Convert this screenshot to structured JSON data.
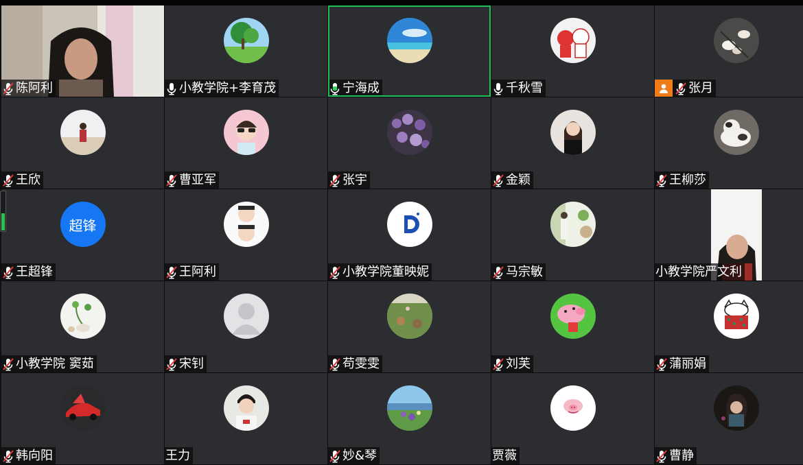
{
  "colors": {
    "tile_bg": "#2b2d31",
    "active_border": "#1ec15a",
    "host_badge": "#f07c19",
    "text_avatar": "#1677f5"
  },
  "audio_level": 0.45,
  "participants": [
    {
      "name": "陈阿利",
      "mic": "muted",
      "avatar": "camera-video"
    },
    {
      "name": "小教学院+李育茂",
      "mic": "on",
      "avatar": "tree-landscape"
    },
    {
      "name": "宁海成",
      "mic": "speaking",
      "avatar": "beach-sky",
      "active": true
    },
    {
      "name": "千秋雪",
      "mic": "on",
      "avatar": "cartoon-pigs"
    },
    {
      "name": "张月",
      "mic": "muted",
      "avatar": "magnolia-flowers",
      "host": true
    },
    {
      "name": "王欣",
      "mic": "muted",
      "avatar": "person-beach"
    },
    {
      "name": "曹亚军",
      "mic": "muted",
      "avatar": "woman-sunglasses"
    },
    {
      "name": "张宇",
      "mic": "muted",
      "avatar": "purple-flowers"
    },
    {
      "name": "金颖",
      "mic": "muted",
      "avatar": "woman-portrait"
    },
    {
      "name": "王柳莎",
      "mic": "muted",
      "avatar": "cat"
    },
    {
      "name": "王超锋",
      "mic": "muted",
      "avatar": "text",
      "avatar_text": "超锋"
    },
    {
      "name": "王阿利",
      "mic": "muted",
      "avatar": "boy-faces"
    },
    {
      "name": "小教学院董映妮",
      "mic": "muted",
      "avatar": "d-logo",
      "logo_letter": "D"
    },
    {
      "name": "马宗敏",
      "mic": "muted",
      "avatar": "woman-garden"
    },
    {
      "name": "小教学院严文利",
      "mic": "none",
      "avatar": "camera-video-card"
    },
    {
      "name": "小教学院 窦茹",
      "mic": "muted",
      "avatar": "vase-plant"
    },
    {
      "name": "宋钊",
      "mic": "muted",
      "avatar": "default-person"
    },
    {
      "name": "苟雯雯",
      "mic": "muted",
      "avatar": "meadow-picnic"
    },
    {
      "name": "刘芙",
      "mic": "muted",
      "avatar": "peppa-pig"
    },
    {
      "name": "蒲丽娟",
      "mic": "muted",
      "avatar": "cat-drawing"
    },
    {
      "name": "韩向阳",
      "mic": "muted",
      "avatar": "red-sports-car"
    },
    {
      "name": "王力",
      "mic": "none",
      "avatar": "young-man"
    },
    {
      "name": "妙&琴",
      "mic": "muted",
      "avatar": "lake-flowers"
    },
    {
      "name": "贾薇",
      "mic": "none",
      "avatar": "pink-pig-face"
    },
    {
      "name": "曹静",
      "mic": "muted",
      "avatar": "dark-portrait"
    }
  ]
}
